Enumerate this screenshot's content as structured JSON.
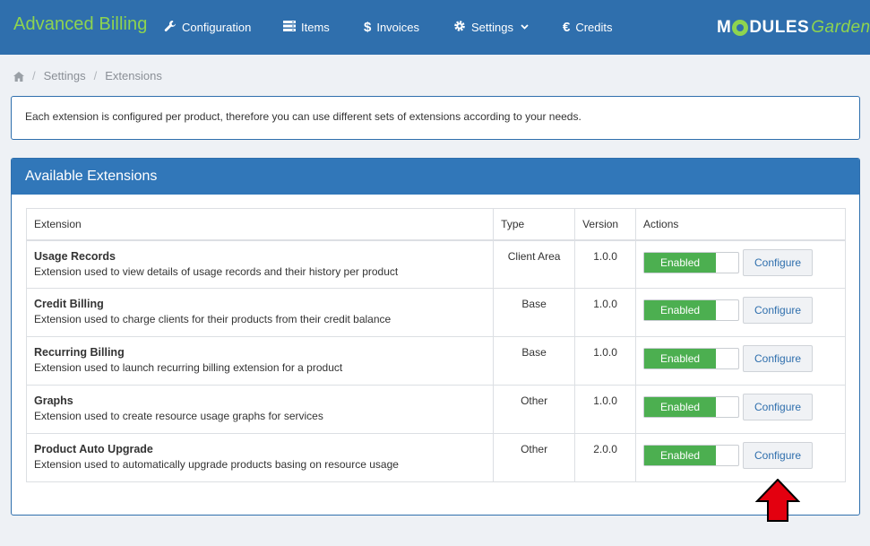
{
  "header": {
    "brand": "Advanced Billing",
    "nav": [
      {
        "label": "Configuration",
        "icon": "wrench-icon"
      },
      {
        "label": "Items",
        "icon": "server-icon"
      },
      {
        "label": "Invoices",
        "icon": "dollar-icon"
      },
      {
        "label": "Settings",
        "icon": "gear-icon"
      },
      {
        "label": "Credits",
        "icon": "euro-icon"
      }
    ],
    "logo_part1": "M",
    "logo_part2": "DULES",
    "logo_part3": "Garden"
  },
  "breadcrumb": {
    "items": [
      "Settings",
      "Extensions"
    ]
  },
  "info_text": "Each extension is configured per product, therefore you can use different sets of extensions according to your needs.",
  "panel": {
    "title": "Available Extensions",
    "columns": [
      "Extension",
      "Type",
      "Version",
      "Actions"
    ],
    "rows": [
      {
        "name": "Usage Records",
        "desc": "Extension used to view details of usage records and their history per product",
        "type": "Client Area",
        "version": "1.0.0",
        "status": "Enabled",
        "action": "Configure"
      },
      {
        "name": "Credit Billing",
        "desc": "Extension used to charge clients for their products from their credit balance",
        "type": "Base",
        "version": "1.0.0",
        "status": "Enabled",
        "action": "Configure"
      },
      {
        "name": "Recurring Billing",
        "desc": "Extension used to launch recurring billing extension for a product",
        "type": "Base",
        "version": "1.0.0",
        "status": "Enabled",
        "action": "Configure"
      },
      {
        "name": "Graphs",
        "desc": "Extension used to create resource usage graphs for services",
        "type": "Other",
        "version": "1.0.0",
        "status": "Enabled",
        "action": "Configure"
      },
      {
        "name": "Product Auto Upgrade",
        "desc": "Extension used to automatically upgrade products basing on resource usage",
        "type": "Other",
        "version": "2.0.0",
        "status": "Enabled",
        "action": "Configure"
      }
    ]
  },
  "colors": {
    "header_bg": "#2f6fad",
    "brand_green": "#8ed44f",
    "toggle_green": "#4caf50",
    "arrow_red": "#e3000f"
  }
}
